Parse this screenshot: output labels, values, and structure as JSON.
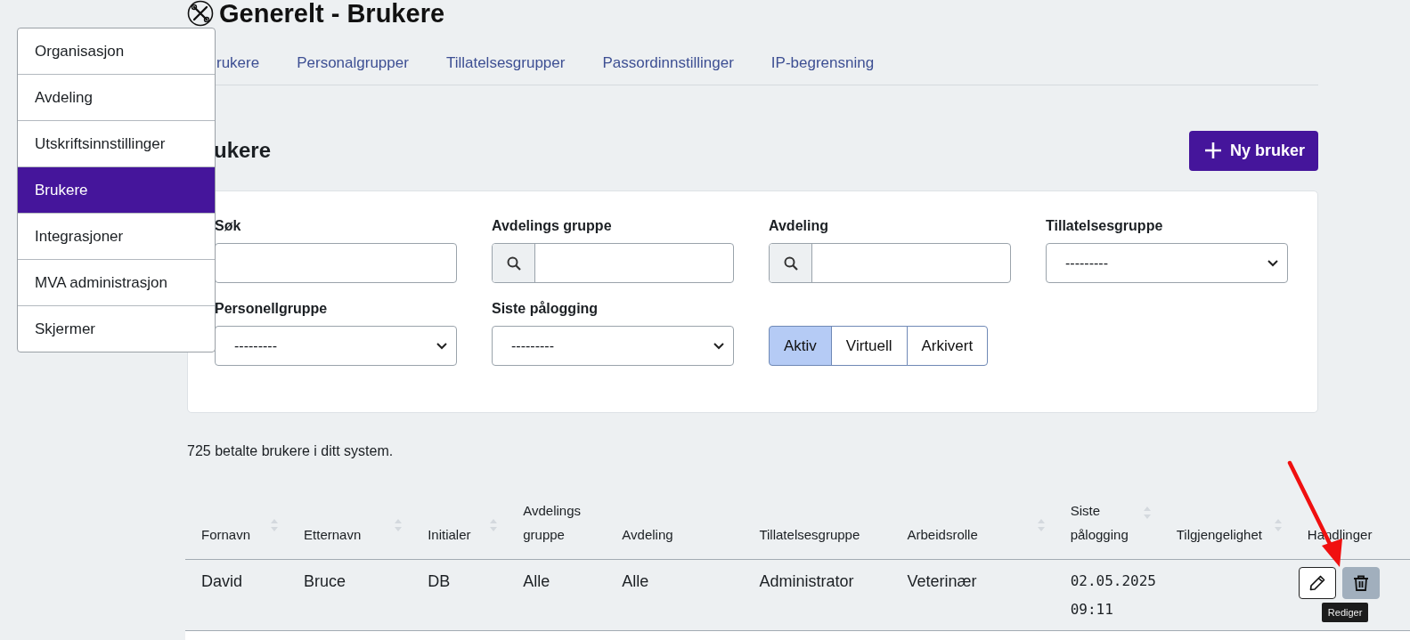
{
  "page_title": "Generelt - Brukere",
  "tabs": [
    {
      "label": "rukere"
    },
    {
      "label": "Personalgrupper"
    },
    {
      "label": "Tillatelsesgrupper"
    },
    {
      "label": "Passordinnstillinger"
    },
    {
      "label": "IP-begrensning"
    }
  ],
  "section_heading": "ukere",
  "new_button": "Ny bruker",
  "filters": [
    {
      "label": "Søk",
      "kind": "text"
    },
    {
      "label": "Avdelings gruppe",
      "kind": "search"
    },
    {
      "label": "Avdeling",
      "kind": "search"
    },
    {
      "label": "Tillatelsesgruppe",
      "kind": "select",
      "value": "---------"
    },
    {
      "label": "Personellgruppe",
      "kind": "select",
      "value": "---------"
    },
    {
      "label": "Siste pålogging",
      "kind": "select",
      "value": "---------"
    },
    {
      "kind": "toggle",
      "options": [
        {
          "label": "Aktiv",
          "selected": true
        },
        {
          "label": "Virtuell",
          "selected": false
        },
        {
          "label": "Arkivert",
          "selected": false
        }
      ]
    }
  ],
  "summary": "725 betalte brukere i ditt system.",
  "table": {
    "columns": [
      {
        "label": "Fornavn",
        "sortable": true
      },
      {
        "label": "Etternavn",
        "sortable": true
      },
      {
        "label": "Initialer",
        "sortable": true
      },
      {
        "label": "Avdelings gruppe",
        "sortable": false
      },
      {
        "label": "Avdeling",
        "sortable": false
      },
      {
        "label": "Tillatelsesgruppe",
        "sortable": false
      },
      {
        "label": "Arbeidsrolle",
        "sortable": true
      },
      {
        "label": "Siste pålogging",
        "sortable": true
      },
      {
        "label": "Tilgjengelighet",
        "sortable": true
      },
      {
        "label": "Handlinger",
        "sortable": false
      }
    ],
    "rows": [
      {
        "cells": [
          "David",
          "Bruce",
          "DB",
          "Alle",
          "Alle",
          "Administrator",
          "Veterinær",
          "02.05.2025 09:11",
          ""
        ],
        "tooltip": "Rediger"
      }
    ]
  },
  "menu": {
    "items": [
      {
        "label": "Organisasjon",
        "selected": false
      },
      {
        "label": "Avdeling",
        "selected": false
      },
      {
        "label": "Utskriftsinnstillinger",
        "selected": false
      },
      {
        "label": "Brukere",
        "selected": true
      },
      {
        "label": "Integrasjoner",
        "selected": false
      },
      {
        "label": "MVA administrasjon",
        "selected": false
      },
      {
        "label": "Skjermer",
        "selected": false
      }
    ]
  }
}
